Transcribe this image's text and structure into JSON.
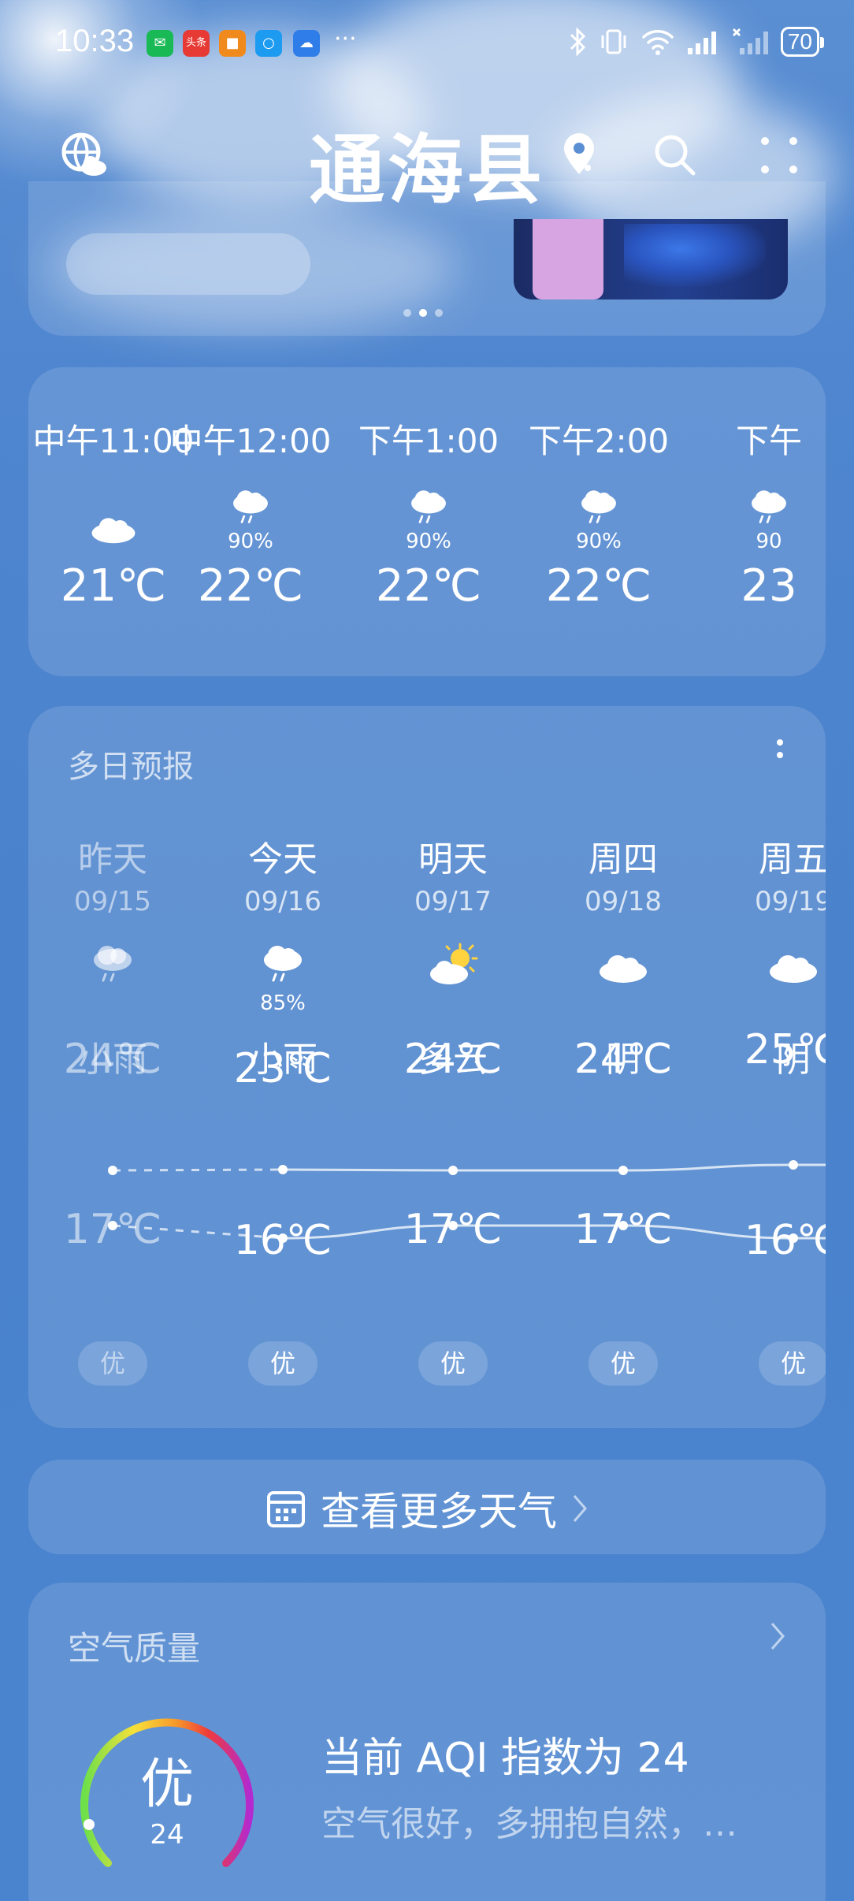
{
  "status_bar": {
    "time": "10:33",
    "notif_toutiao": "头条",
    "more": "···",
    "battery": "70"
  },
  "header": {
    "city": "通海县"
  },
  "hourly": [
    {
      "label": "中午11:00",
      "icon": "cloudy-icon",
      "precip": "",
      "temp": "21℃"
    },
    {
      "label": "中午12:00",
      "icon": "rain-icon",
      "precip": "90%",
      "temp": "22℃"
    },
    {
      "label": "下午1:00",
      "icon": "rain-icon",
      "precip": "90%",
      "temp": "22℃"
    },
    {
      "label": "下午2:00",
      "icon": "rain-icon",
      "precip": "90%",
      "temp": "22℃"
    },
    {
      "label": "下午",
      "icon": "rain-icon",
      "precip": "90",
      "temp": "23"
    }
  ],
  "daily": {
    "title": "多日预报",
    "days": [
      {
        "name": "昨天",
        "date": "09/15",
        "icon": "rain-icon",
        "precip": "",
        "cond": "小雨",
        "high": "24℃",
        "low": "17℃",
        "aqi": "优",
        "past": true
      },
      {
        "name": "今天",
        "date": "09/16",
        "icon": "rain-icon",
        "precip": "85%",
        "cond": "小雨",
        "high": "23℃",
        "low": "16℃",
        "aqi": "优",
        "past": false
      },
      {
        "name": "明天",
        "date": "09/17",
        "icon": "partly-cloudy-icon",
        "precip": "",
        "cond": "多云",
        "high": "24℃",
        "low": "17℃",
        "aqi": "优",
        "past": false
      },
      {
        "name": "周四",
        "date": "09/18",
        "icon": "cloudy-icon",
        "precip": "",
        "cond": "阴",
        "high": "24℃",
        "low": "17℃",
        "aqi": "优",
        "past": false
      },
      {
        "name": "周五",
        "date": "09/19",
        "icon": "cloudy-icon",
        "precip": "",
        "cond": "阴",
        "high": "25℃",
        "low": "16℃",
        "aqi": "优",
        "past": false
      }
    ]
  },
  "more_weather": {
    "label": "查看更多天气"
  },
  "air_quality": {
    "title": "空气质量",
    "level": "优",
    "value": "24",
    "headline": "当前 AQI 指数为 24",
    "desc": "空气很好，多拥抱自然，…"
  },
  "colors": {
    "background": "#4f86cf",
    "card": "rgba(255,255,255,0.13)"
  }
}
